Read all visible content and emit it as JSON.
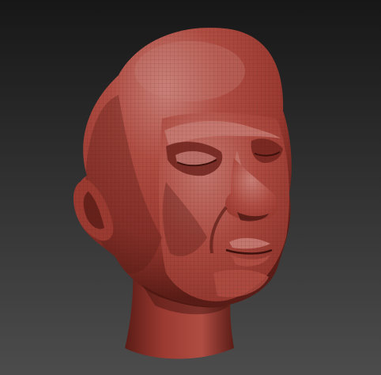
{
  "viewport": {
    "background_top": "#171717",
    "background_bottom": "#4c4c4c"
  },
  "model": {
    "subject": "sculpted-head",
    "material_colors": {
      "base": "#9b3a31",
      "highlight": "#c98078",
      "mid": "#b04d43",
      "shadow": "#5a1c16",
      "deep_shadow": "#3e110d"
    },
    "wireframe_visible": true
  }
}
